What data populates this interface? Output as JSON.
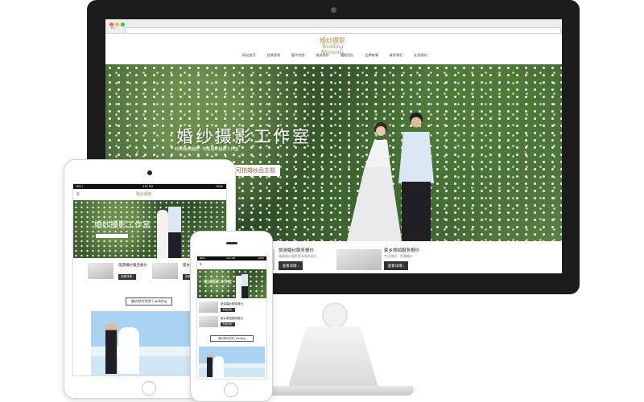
{
  "site": {
    "logo_cn": "婚纱摄影",
    "logo_en": "Wedding Moments",
    "nav": [
      "网站首页",
      "经典案例",
      "客片欣赏",
      "服务报价",
      "摄影团队",
      "品牌故事",
      "联系我们",
      "在线预约"
    ]
  },
  "hero": {
    "title": "婚纱摄影工作室",
    "subtitle": "时尚婚纱摄影 · 专业婚纱摄影工作室",
    "button": "拍可拍婚纱品主题"
  },
  "services": [
    {
      "title": "旅游婚纱服务报价",
      "desc": "精美婚纱摄影套系服务报价",
      "button": "查看详情 ›"
    },
    {
      "title": "家乡旅拍服务报价",
      "desc": "专业旅拍 · 浪漫婚纱",
      "button": "查看详情 ›"
    }
  ],
  "mobile": {
    "status_time": "4:21 PM",
    "status_carrier": "BELL",
    "battery": "100%",
    "hero_title": "婚纱摄影工作室",
    "section_tag": "婚纱照片欣赏 | wedding"
  }
}
